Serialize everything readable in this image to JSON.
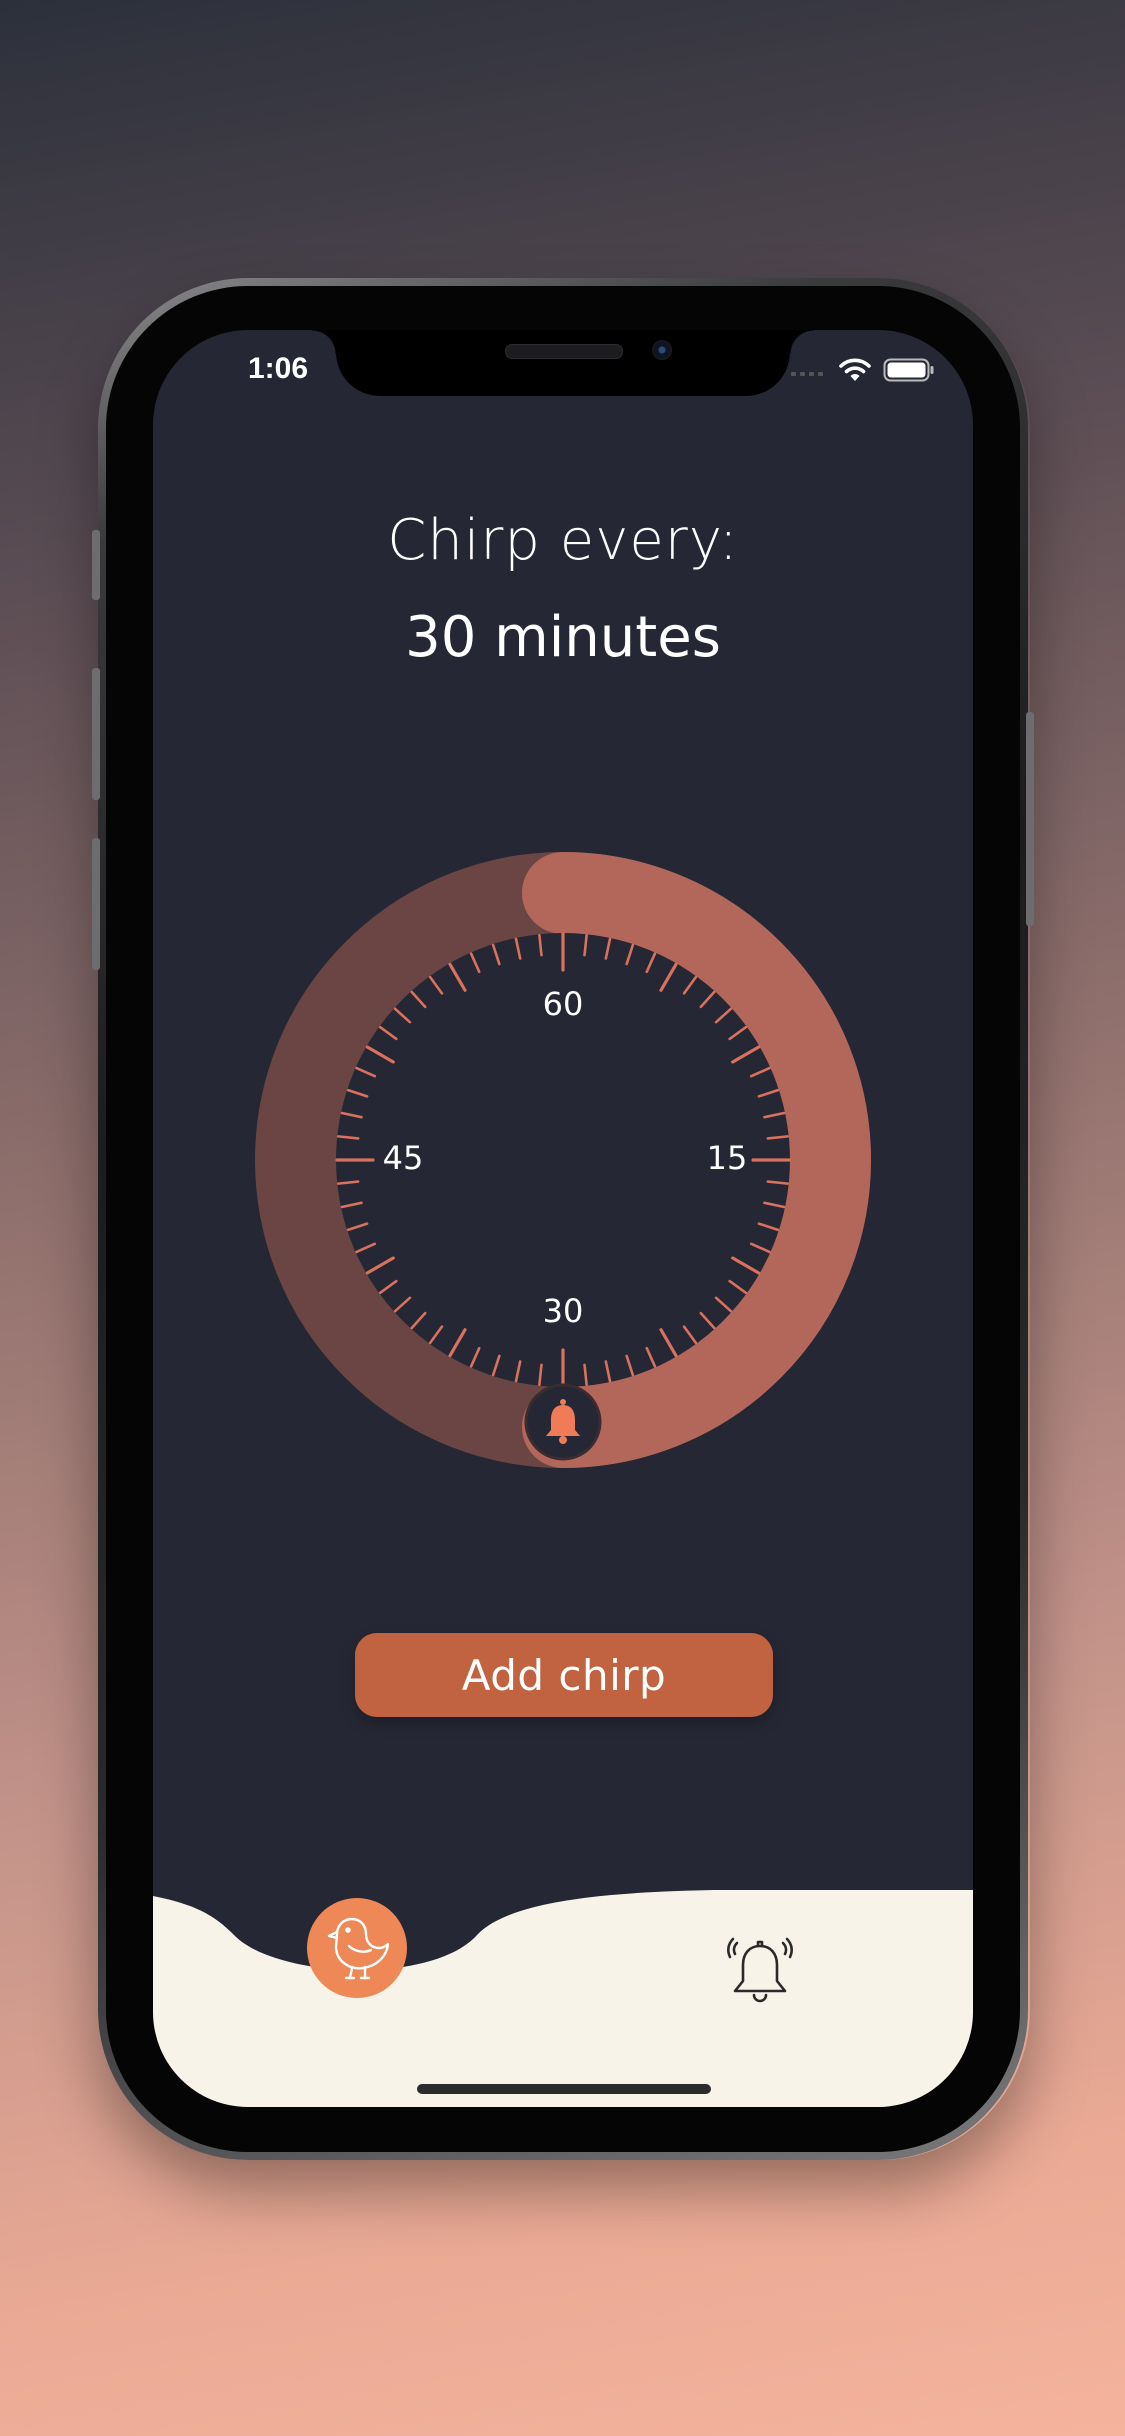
{
  "status_bar": {
    "time": "1:06",
    "icons": [
      "cellular-signal-icon",
      "wifi-icon",
      "battery-icon"
    ]
  },
  "header": {
    "title": "Chirp every:",
    "interval_value": "30 minutes"
  },
  "dial": {
    "labels": [
      "60",
      "15",
      "30",
      "45"
    ],
    "selected_minutes": 30,
    "max_minutes": 60,
    "handle_icon": "bell-icon",
    "colors": {
      "track": "#6a4544",
      "progress": "#b3675a",
      "ticks": "#d8715d",
      "face": "#252734"
    }
  },
  "actions": {
    "add_label": "Add chirp"
  },
  "tab_bar": {
    "tabs": [
      {
        "icon": "bird-icon",
        "active": true
      },
      {
        "icon": "alarm-bell-icon",
        "active": false
      }
    ]
  },
  "colors": {
    "accent": "#ef8857",
    "button": "#c16341",
    "screen_background": "#252734",
    "tab_bar_background": "#f7f3e8"
  }
}
